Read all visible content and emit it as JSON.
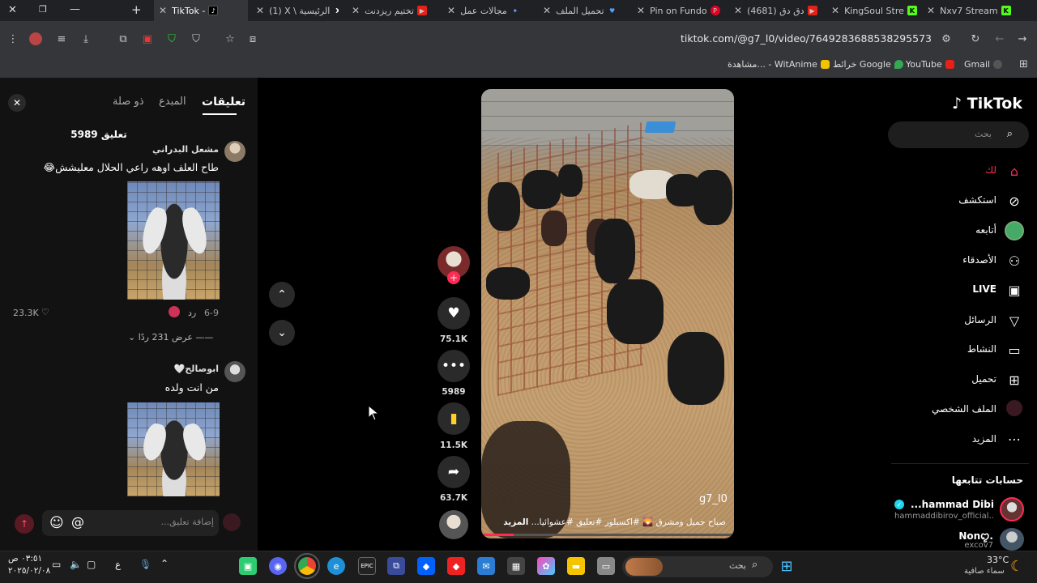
{
  "browser": {
    "tabs": [
      {
        "label": "TikTok - ",
        "active": true
      },
      {
        "label": "(1) X \\ الرئيسية"
      },
      {
        "label": "تختيم ريزدنت"
      },
      {
        "label": "مجالات عمل"
      },
      {
        "label": "تحميل الملف"
      },
      {
        "label": "Pin on Fundo"
      },
      {
        "label": "(4681) دق دق"
      },
      {
        "label": "KingSoul Stre"
      },
      {
        "label": "Nxv7 Stream"
      }
    ],
    "url": "tiktok.com/@g7_l0/video/7649283688538295573",
    "bookmarks": [
      "Gmail",
      "YouTube",
      "خرائط Google",
      "مشاهدة... - WitAnime"
    ]
  },
  "comments": {
    "tabs": [
      "تعليقات",
      "المبدع",
      "ذو صلة"
    ],
    "count": "5989 تعليق",
    "items": [
      {
        "name": "مشعل البدراني",
        "text": "طاح العلف اوهه راعي الحلال معليشش😂",
        "date": "6-9",
        "reply": "رد",
        "likes": "23.3K",
        "view_replies": "عرض 231 ردًا"
      },
      {
        "name": "ابوصالح🤍",
        "text": "من انت ولده"
      }
    ],
    "input_placeholder": "إضافة تعليق..."
  },
  "video": {
    "username": "g7_l0",
    "caption": "صباح جميل ومشرق 🌄 #اكسبلور #تعليق #عشوائيا...",
    "more": "المزيد"
  },
  "actions": {
    "likes": "75.1K",
    "comments": "5989",
    "saves": "11.5K",
    "shares": "63.7K"
  },
  "sidebar": {
    "logo": "TikTok",
    "search_placeholder": "بحث",
    "nav": [
      "لك",
      "استكشف",
      "أتابعه",
      "الأصدقاء",
      "LIVE",
      "الرسائل",
      "النشاط",
      "تحميل",
      "الملف الشخصي",
      "المزيد"
    ],
    "following_title": "حسابات تتابعها",
    "following": [
      {
        "name": "...hammad Dibirov",
        "handle": "hammaddibirov_official..."
      },
      {
        "name": "Nonꨄ.",
        "handle": "excov7"
      }
    ]
  },
  "taskbar": {
    "search": "بحث",
    "weather_temp": "33°C",
    "weather_desc": "سماء صافية",
    "time": "٠٣:٥١ ص",
    "date": "٢٠٢٥/٠٢/٠٨",
    "lang": "ع"
  },
  "colors": {
    "accent": "#fe2c55",
    "bg": "#000000",
    "panel": "#121212"
  }
}
